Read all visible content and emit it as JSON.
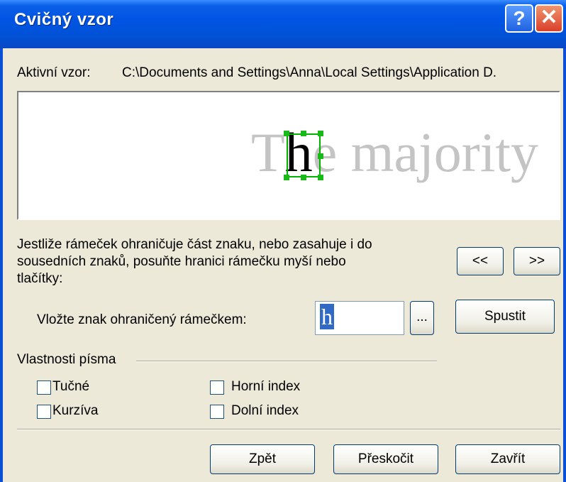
{
  "window": {
    "title": "Cvičný vzor",
    "help_glyph": "?",
    "close_glyph": "✕"
  },
  "active_pattern": {
    "label": "Aktivní vzor:",
    "path": "C:\\Documents and Settings\\Anna\\Local Settings\\Application D."
  },
  "preview": {
    "before": "T",
    "current": "h",
    "after": "e majority"
  },
  "instructions": {
    "line1": "Jestliže rámeček ohraničuje část znaku, nebo zasahuje i do",
    "line2": "sousedních znaků, posuňte hranici rámečku myší nebo",
    "line3": "tlačítky:"
  },
  "nav": {
    "prev_label": "<<",
    "next_label": ">>"
  },
  "char_entry": {
    "label": "Vložte znak ohraničený rámečkem:",
    "value": "h",
    "browse_label": "...",
    "start_label": "Spustit"
  },
  "font_props": {
    "group_label": "Vlastnosti písma",
    "bold": "Tučné",
    "italic": "Kurzíva",
    "superscript": "Horní index",
    "subscript": "Dolní index"
  },
  "footer": {
    "back_label": "Zpět",
    "skip_label": "Přeskočit",
    "close_label": "Zavřít"
  }
}
